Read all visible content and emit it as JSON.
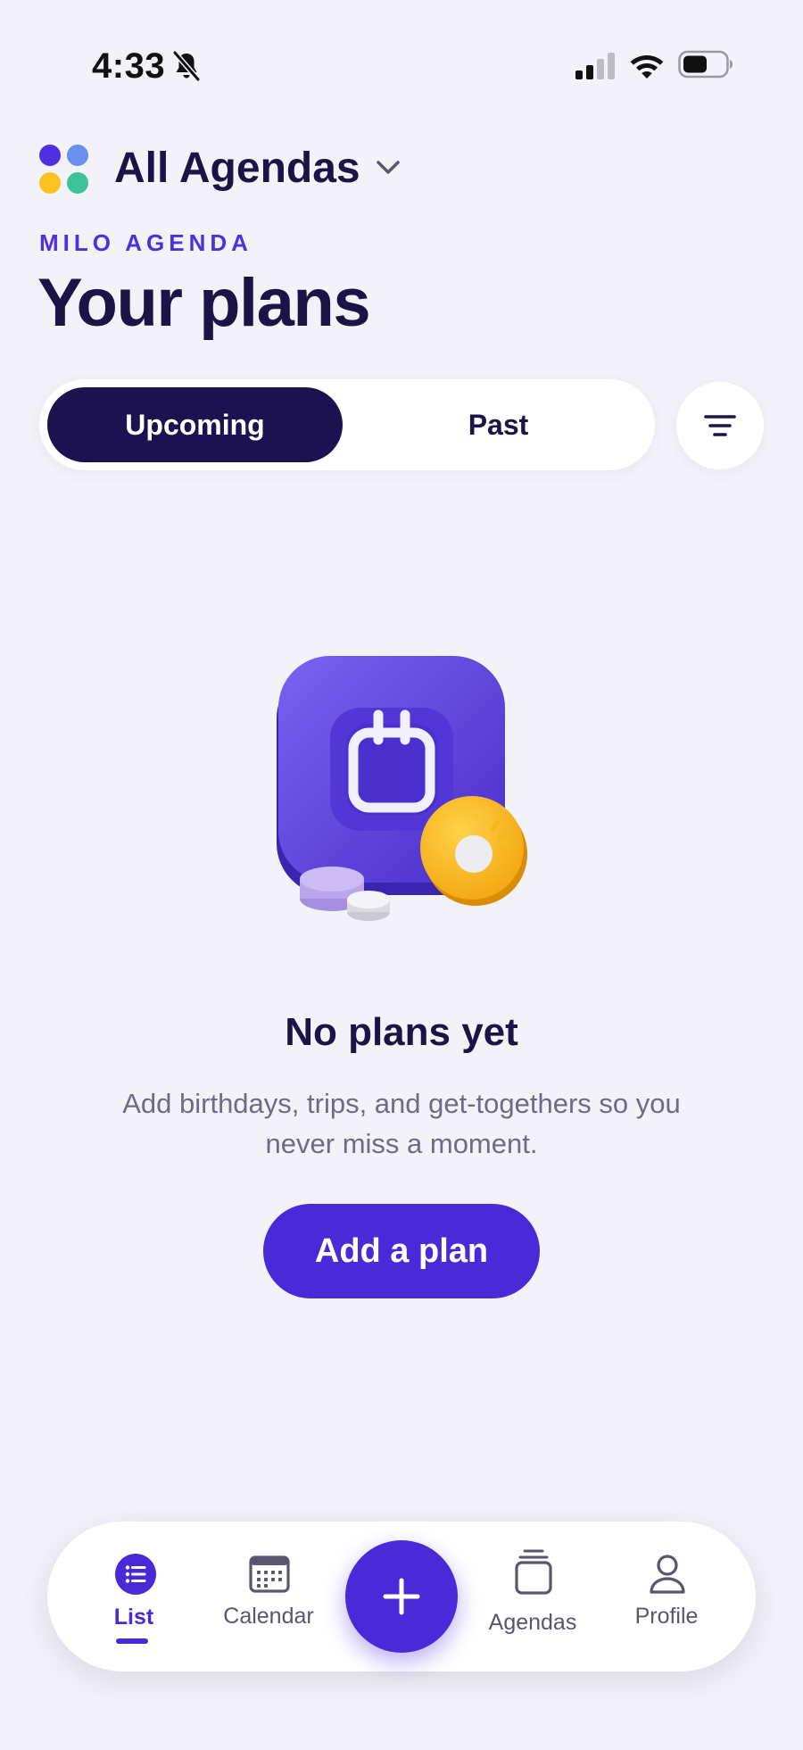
{
  "status_bar": {
    "time": "4:33",
    "icons": [
      "bell-muted-icon",
      "cellular-signal-icon",
      "wifi-icon",
      "battery-icon"
    ]
  },
  "header": {
    "agenda_selector": "All Agendas",
    "eyebrow": "MILO AGENDA",
    "title": "Your plans"
  },
  "tabs": [
    {
      "label": "Upcoming",
      "active": true
    },
    {
      "label": "Past",
      "active": false
    }
  ],
  "filter": {
    "icon": "filter-icon"
  },
  "empty_state": {
    "illustration": "calendar-illustration",
    "title": "No plans yet",
    "description": "Add birthdays, trips, and get-togethers so you never miss a moment.",
    "cta": "Add a plan"
  },
  "bottom_nav": {
    "items": [
      {
        "label": "List",
        "icon": "list-icon",
        "active": true
      },
      {
        "label": "Calendar",
        "icon": "calendar-icon",
        "active": false
      },
      {
        "label": "Agendas",
        "icon": "agendas-icon",
        "active": false
      },
      {
        "label": "Profile",
        "icon": "profile-icon",
        "active": false
      }
    ],
    "fab_icon": "plus-icon"
  },
  "colors": {
    "background": "#F3F2F8",
    "primary": "#4A2AD8",
    "dark": "#1D1250",
    "eyebrow": "#4F2FE0",
    "muted_text": "#6E6A8A",
    "dot_purple": "#4F2FE0",
    "dot_blue": "#6B8FF0",
    "dot_yellow": "#FDC121",
    "dot_green": "#3CC39A"
  }
}
